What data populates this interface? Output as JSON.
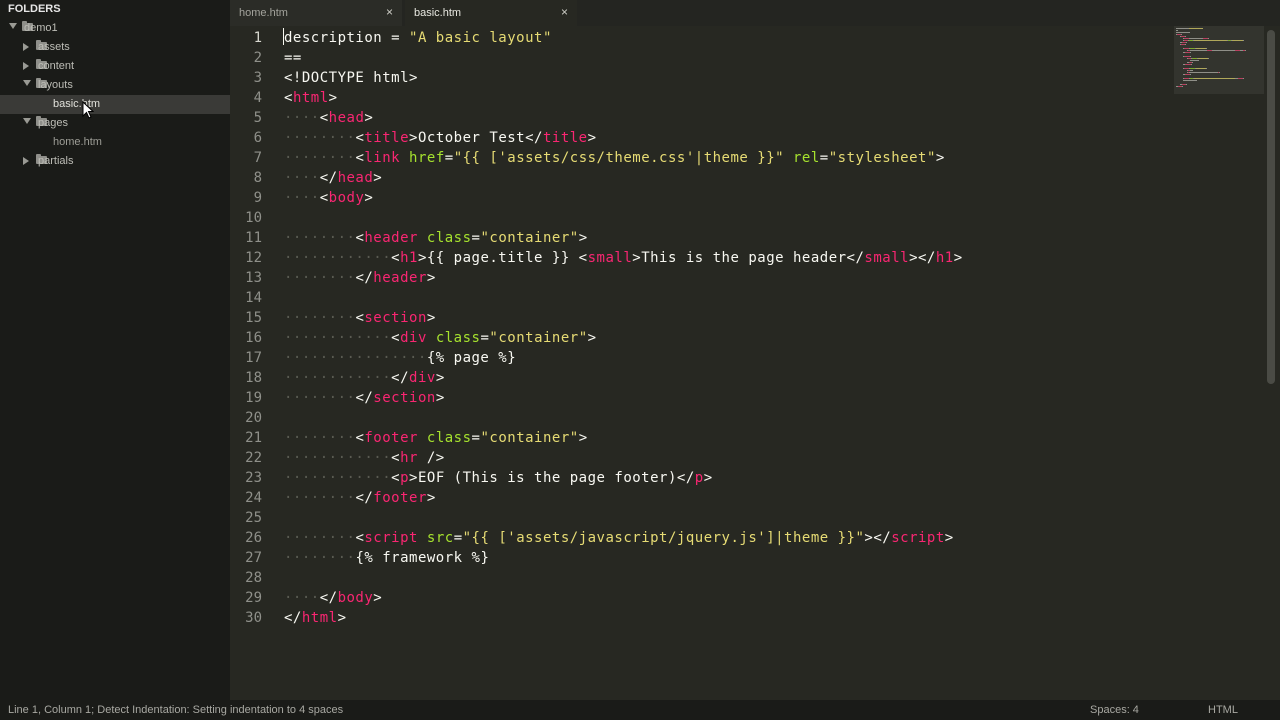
{
  "sidebar": {
    "title": "FOLDERS",
    "items": [
      {
        "label": "demo1",
        "type": "folder",
        "open": true,
        "depth": 0
      },
      {
        "label": "assets",
        "type": "folder",
        "open": false,
        "depth": 1
      },
      {
        "label": "content",
        "type": "folder",
        "open": false,
        "depth": 1
      },
      {
        "label": "layouts",
        "type": "folder",
        "open": true,
        "depth": 1
      },
      {
        "label": "basic.htm",
        "type": "file",
        "depth": 2,
        "selected": true
      },
      {
        "label": "pages",
        "type": "folder",
        "open": true,
        "depth": 1
      },
      {
        "label": "home.htm",
        "type": "file",
        "depth": 2
      },
      {
        "label": "partials",
        "type": "folder",
        "open": false,
        "depth": 1
      }
    ]
  },
  "tabs": [
    {
      "label": "home.htm",
      "close": "×",
      "active": false
    },
    {
      "label": "basic.htm",
      "close": "×",
      "active": true
    }
  ],
  "editor": {
    "current_line": 1,
    "lines": [
      [
        [
          "p",
          "description = "
        ],
        [
          "s",
          "\"A basic layout\""
        ]
      ],
      [
        [
          "p",
          "=="
        ]
      ],
      [
        [
          "p",
          "<!DOCTYPE html>"
        ]
      ],
      [
        [
          "p",
          "<"
        ],
        [
          "t",
          "html"
        ],
        [
          "p",
          ">"
        ]
      ],
      [
        [
          "w",
          "····"
        ],
        [
          "p",
          "<"
        ],
        [
          "t",
          "head"
        ],
        [
          "p",
          ">"
        ]
      ],
      [
        [
          "w",
          "········"
        ],
        [
          "p",
          "<"
        ],
        [
          "t",
          "title"
        ],
        [
          "p",
          ">October Test</"
        ],
        [
          "t",
          "title"
        ],
        [
          "p",
          ">"
        ]
      ],
      [
        [
          "w",
          "········"
        ],
        [
          "p",
          "<"
        ],
        [
          "t",
          "link"
        ],
        [
          "p",
          " "
        ],
        [
          "a",
          "href"
        ],
        [
          "p",
          "="
        ],
        [
          "s",
          "\"{{ ['assets/css/theme.css'|theme }}\""
        ],
        [
          "p",
          " "
        ],
        [
          "a",
          "rel"
        ],
        [
          "p",
          "="
        ],
        [
          "s",
          "\"stylesheet\""
        ],
        [
          "p",
          ">"
        ]
      ],
      [
        [
          "w",
          "····"
        ],
        [
          "p",
          "</"
        ],
        [
          "t",
          "head"
        ],
        [
          "p",
          ">"
        ]
      ],
      [
        [
          "w",
          "····"
        ],
        [
          "p",
          "<"
        ],
        [
          "t",
          "body"
        ],
        [
          "p",
          ">"
        ]
      ],
      [],
      [
        [
          "w",
          "········"
        ],
        [
          "p",
          "<"
        ],
        [
          "t",
          "header"
        ],
        [
          "p",
          " "
        ],
        [
          "a",
          "class"
        ],
        [
          "p",
          "="
        ],
        [
          "s",
          "\"container\""
        ],
        [
          "p",
          ">"
        ]
      ],
      [
        [
          "w",
          "············"
        ],
        [
          "p",
          "<"
        ],
        [
          "t",
          "h1"
        ],
        [
          "p",
          ">{{ page.title }} <"
        ],
        [
          "t",
          "small"
        ],
        [
          "p",
          ">This is the page header</"
        ],
        [
          "t",
          "small"
        ],
        [
          "p",
          "></"
        ],
        [
          "t",
          "h1"
        ],
        [
          "p",
          ">"
        ]
      ],
      [
        [
          "w",
          "········"
        ],
        [
          "p",
          "</"
        ],
        [
          "t",
          "header"
        ],
        [
          "p",
          ">"
        ]
      ],
      [],
      [
        [
          "w",
          "········"
        ],
        [
          "p",
          "<"
        ],
        [
          "t",
          "section"
        ],
        [
          "p",
          ">"
        ]
      ],
      [
        [
          "w",
          "············"
        ],
        [
          "p",
          "<"
        ],
        [
          "t",
          "div"
        ],
        [
          "p",
          " "
        ],
        [
          "a",
          "class"
        ],
        [
          "p",
          "="
        ],
        [
          "s",
          "\"container\""
        ],
        [
          "p",
          ">"
        ]
      ],
      [
        [
          "w",
          "················"
        ],
        [
          "p",
          "{% page %}"
        ]
      ],
      [
        [
          "w",
          "············"
        ],
        [
          "p",
          "</"
        ],
        [
          "t",
          "div"
        ],
        [
          "p",
          ">"
        ]
      ],
      [
        [
          "w",
          "········"
        ],
        [
          "p",
          "</"
        ],
        [
          "t",
          "section"
        ],
        [
          "p",
          ">"
        ]
      ],
      [],
      [
        [
          "w",
          "········"
        ],
        [
          "p",
          "<"
        ],
        [
          "t",
          "footer"
        ],
        [
          "p",
          " "
        ],
        [
          "a",
          "class"
        ],
        [
          "p",
          "="
        ],
        [
          "s",
          "\"container\""
        ],
        [
          "p",
          ">"
        ]
      ],
      [
        [
          "w",
          "············"
        ],
        [
          "p",
          "<"
        ],
        [
          "t",
          "hr"
        ],
        [
          "p",
          " />"
        ]
      ],
      [
        [
          "w",
          "············"
        ],
        [
          "p",
          "<"
        ],
        [
          "t",
          "p"
        ],
        [
          "p",
          ">EOF (This is the page footer)</"
        ],
        [
          "t",
          "p"
        ],
        [
          "p",
          ">"
        ]
      ],
      [
        [
          "w",
          "········"
        ],
        [
          "p",
          "</"
        ],
        [
          "t",
          "footer"
        ],
        [
          "p",
          ">"
        ]
      ],
      [],
      [
        [
          "w",
          "········"
        ],
        [
          "p",
          "<"
        ],
        [
          "t",
          "script"
        ],
        [
          "p",
          " "
        ],
        [
          "a",
          "src"
        ],
        [
          "p",
          "="
        ],
        [
          "s",
          "\"{{ ['assets/javascript/jquery.js']|theme }}\""
        ],
        [
          "p",
          "></"
        ],
        [
          "t",
          "script"
        ],
        [
          "p",
          ">"
        ]
      ],
      [
        [
          "w",
          "········"
        ],
        [
          "p",
          "{% framework %}"
        ]
      ],
      [],
      [
        [
          "w",
          "····"
        ],
        [
          "p",
          "</"
        ],
        [
          "t",
          "body"
        ],
        [
          "p",
          ">"
        ]
      ],
      [
        [
          "p",
          "</"
        ],
        [
          "t",
          "html"
        ],
        [
          "p",
          ">"
        ]
      ]
    ]
  },
  "status": {
    "message": "Line 1, Column 1; Detect Indentation: Setting indentation to 4 spaces",
    "spaces": "Spaces: 4",
    "syntax": "HTML"
  },
  "colors": {
    "tag": "#f92672",
    "attr": "#a6e22e",
    "string": "#e6db74",
    "text": "#f8f8f2"
  }
}
